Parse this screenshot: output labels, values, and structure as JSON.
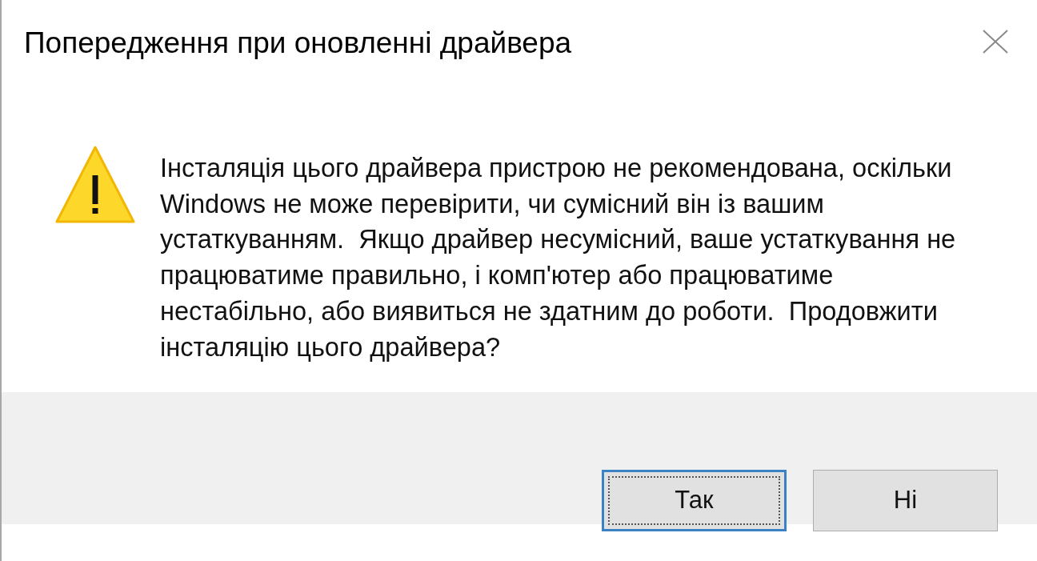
{
  "window": {
    "title": "Попередження при оновленні драйвера"
  },
  "message": {
    "text": "Інсталяція цього драйвера пристрою не рекомендована, оскільки Windows не може перевірити, чи сумісний він із вашим устаткуванням.  Якщо драйвер несумісний, ваше устаткування не працюватиме правильно, і комп'ютер або працюватиме нестабільно, або виявиться не здатним до роботи.  Продовжити інсталяцію цього драйвера?"
  },
  "buttons": [
    {
      "label": "Так",
      "focused": true
    },
    {
      "label": "Ні",
      "focused": false
    }
  ]
}
